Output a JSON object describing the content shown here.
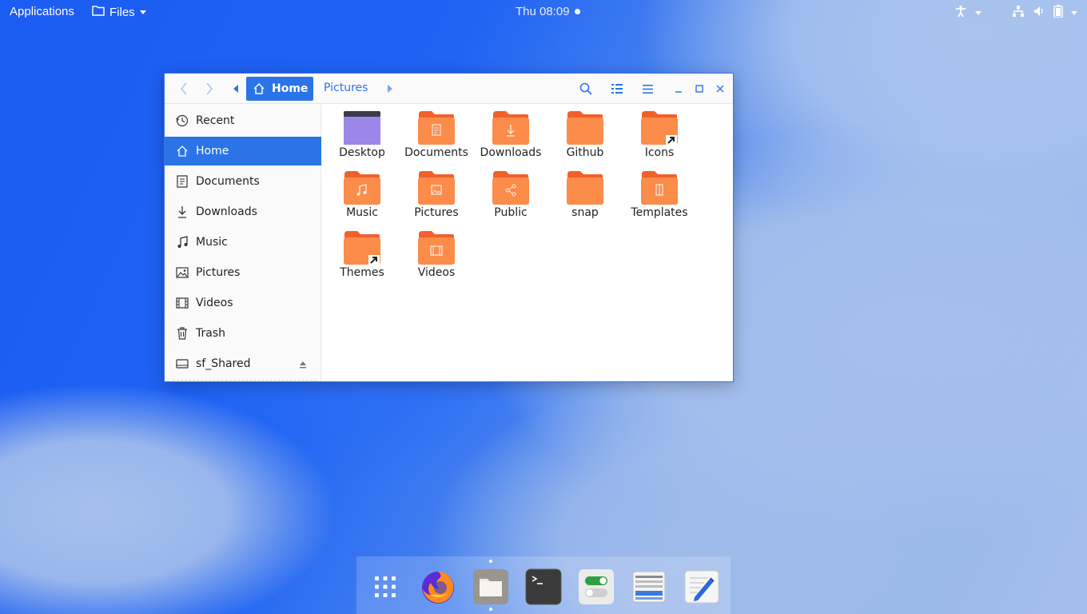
{
  "topbar": {
    "applications": "Applications",
    "files_menu": "Files",
    "clock": "Thu 08:09",
    "icons": [
      "accessibility-icon",
      "network-icon",
      "volume-icon",
      "battery-icon"
    ]
  },
  "window": {
    "breadcrumb": {
      "home": "Home",
      "pictures": "Pictures"
    },
    "sidebar": {
      "items": [
        {
          "label": "Recent",
          "icon": "clock-icon"
        },
        {
          "label": "Home",
          "icon": "home-icon",
          "active": true
        },
        {
          "label": "Documents",
          "icon": "document-icon"
        },
        {
          "label": "Downloads",
          "icon": "download-icon"
        },
        {
          "label": "Music",
          "icon": "music-icon"
        },
        {
          "label": "Pictures",
          "icon": "picture-icon"
        },
        {
          "label": "Videos",
          "icon": "film-icon"
        },
        {
          "label": "Trash",
          "icon": "trash-icon"
        },
        {
          "label": "sf_Shared",
          "icon": "drive-icon"
        }
      ]
    },
    "folders": [
      {
        "label": "Desktop",
        "kind": "desktop"
      },
      {
        "label": "Documents",
        "kind": "documents"
      },
      {
        "label": "Downloads",
        "kind": "downloads"
      },
      {
        "label": "Github",
        "kind": "plain"
      },
      {
        "label": "Icons",
        "kind": "link"
      },
      {
        "label": "Music",
        "kind": "music"
      },
      {
        "label": "Pictures",
        "kind": "pictures"
      },
      {
        "label": "Public",
        "kind": "public"
      },
      {
        "label": "snap",
        "kind": "plain"
      },
      {
        "label": "Templates",
        "kind": "templates"
      },
      {
        "label": "Themes",
        "kind": "link"
      },
      {
        "label": "Videos",
        "kind": "videos"
      }
    ]
  },
  "dock": {
    "items": [
      "app-grid-icon",
      "firefox-icon",
      "files-icon",
      "terminal-icon",
      "settings-icon",
      "system-monitor-icon",
      "text-editor-icon"
    ]
  },
  "colors": {
    "accent": "#2a74e8",
    "folder": "#fb8c4a",
    "folder_tab": "#f2602a",
    "desktop_folder": "#8b6fe0"
  }
}
